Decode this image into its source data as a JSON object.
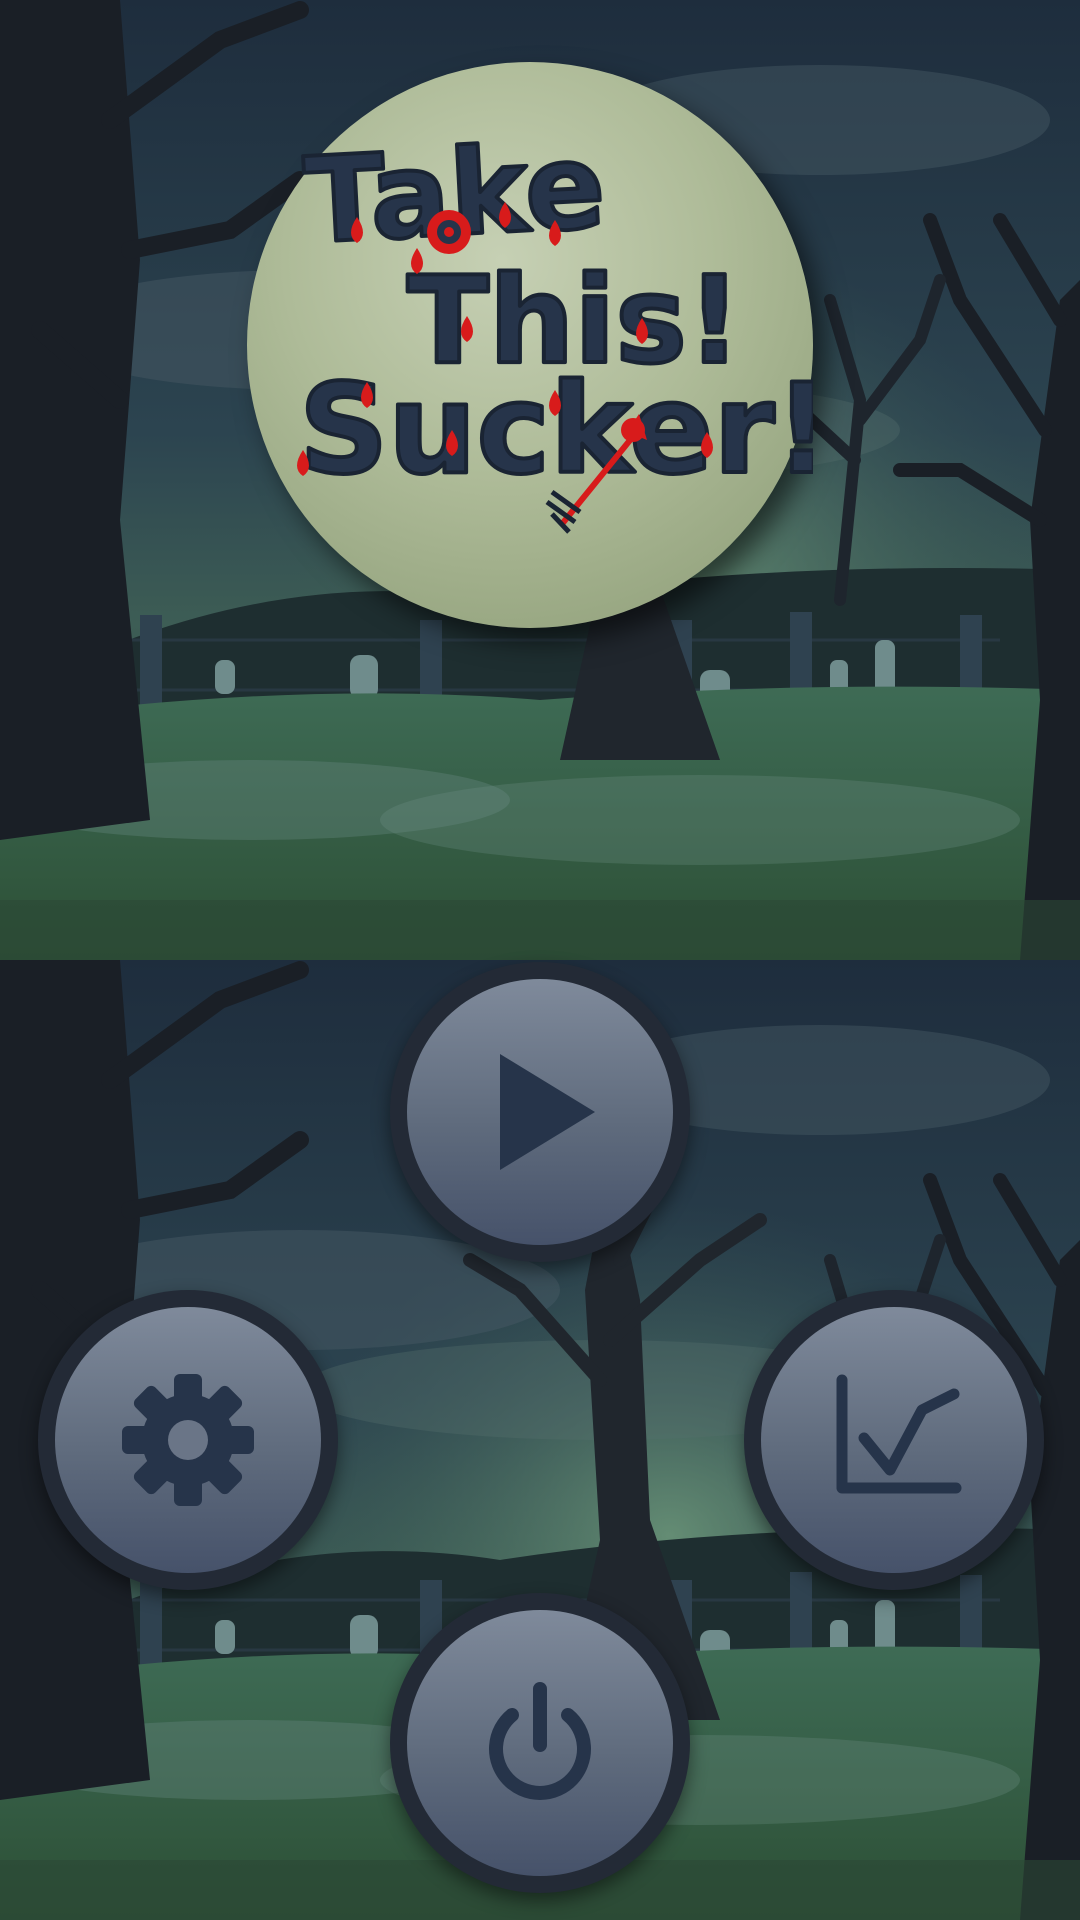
{
  "game": {
    "title_lines": [
      "Take",
      "This!",
      "Sucker!"
    ]
  },
  "menu": {
    "buttons": [
      {
        "id": "play",
        "icon": "play-icon"
      },
      {
        "id": "settings",
        "icon": "gear-icon"
      },
      {
        "id": "stats",
        "icon": "chart-icon"
      },
      {
        "id": "power",
        "icon": "power-icon"
      }
    ]
  },
  "colors": {
    "title_text": "#26344a",
    "blood": "#d81b1b",
    "button_ring": "#232a36",
    "icon": "#26344a",
    "logo_disc": "#b8c4a4"
  }
}
